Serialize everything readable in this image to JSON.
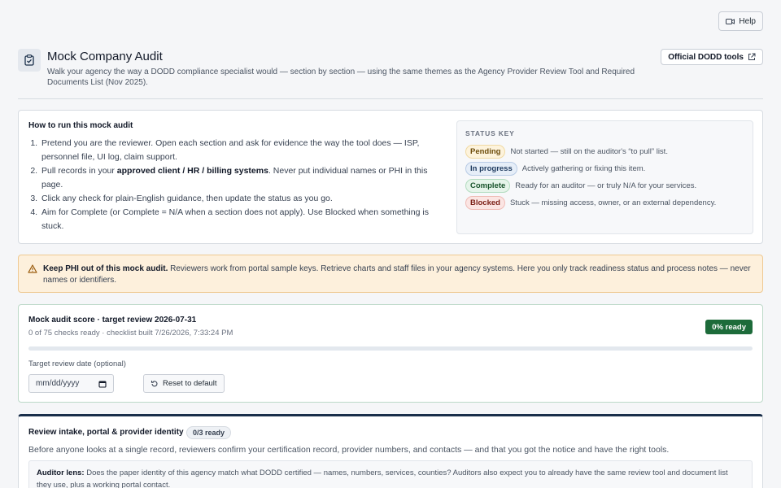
{
  "help": {
    "label": "Help",
    "icon": "video-icon"
  },
  "header": {
    "icon": "clipboard-check-icon",
    "title": "Mock Company Audit",
    "subtitle": "Walk your agency the way a DODD compliance specialist would — section by section — using the same themes as the Agency Provider Review Tool and Required Documents List (Nov 2025).",
    "dodd_button": "Official DODD tools",
    "dodd_icon": "external-link-icon"
  },
  "howto": {
    "title": "How to run this mock audit",
    "steps": [
      {
        "pre": "Pretend you are the reviewer. Open each section and ask for evidence the way the tool does — ISP, personnel file, UI log, claim support.",
        "bold": "",
        "post": ""
      },
      {
        "pre": "Pull records in your ",
        "bold": "approved client / HR / billing systems",
        "post": ". Never put individual names or PHI in this page."
      },
      {
        "pre": "Click any check for plain-English guidance, then update the status as you go.",
        "bold": "",
        "post": ""
      },
      {
        "pre": "Aim for Complete (or Complete = N/A when a section does not apply). Use Blocked when something is stuck.",
        "bold": "",
        "post": ""
      }
    ]
  },
  "status_key": {
    "title": "STATUS KEY",
    "items": [
      {
        "label": "Pending",
        "desc": "Not started — still on the auditor's “to pull” list."
      },
      {
        "label": "In progress",
        "desc": "Actively gathering or fixing this item."
      },
      {
        "label": "Complete",
        "desc": "Ready for an auditor — or truly N/A for your services."
      },
      {
        "label": "Blocked",
        "desc": "Stuck — missing access, owner, or an external dependency."
      }
    ]
  },
  "warning": {
    "icon": "warning-triangle-icon",
    "bold": "Keep PHI out of this mock audit.",
    "text": " Reviewers work from portal sample keys. Retrieve charts and staff files in your agency systems. Here you only track readiness status and process notes — never names or identifiers."
  },
  "score": {
    "title": "Mock audit score · target review 2026-07-31",
    "subtitle": "0 of 75 checks ready · checklist built 7/26/2026, 7:33:24 PM",
    "ready": "0% ready",
    "progress": 0,
    "date_label": "Target review date (optional)",
    "date_placeholder": "mm/dd/yyyy",
    "reset": "Reset to default"
  },
  "section": {
    "title": "Review intake, portal & provider identity",
    "badge": "0/3 ready",
    "desc": "Before anyone looks at a single record, reviewers confirm your certification record, provider numbers, and contacts — and that you got the notice and have the right tools.",
    "lens_bold": "Auditor lens:",
    "lens_text": " Does the paper identity of this agency match what DODD certified — names, numbers, services, counties? Auditors also expect you to already have the same review tool and document list they use, plus a working portal contact."
  },
  "colors": {
    "accent_green": "#1d6b3a",
    "navy": "#1a2f4a",
    "warning_bg": "#fdf0dc"
  }
}
